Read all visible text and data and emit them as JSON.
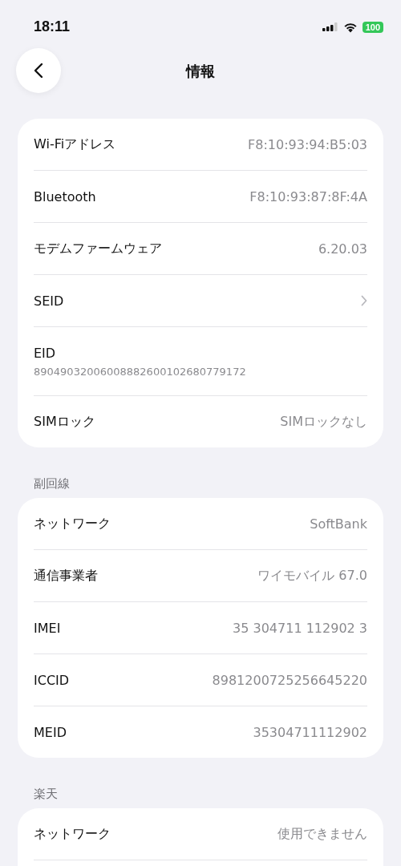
{
  "status_bar": {
    "time": "18:11",
    "battery": "100"
  },
  "header": {
    "title": "情報"
  },
  "sections": [
    {
      "rows": [
        {
          "kind": "value",
          "label": "Wi-Fiアドレス",
          "value": "F8:10:93:94:B5:03"
        },
        {
          "kind": "value",
          "label": "Bluetooth",
          "value": "F8:10:93:87:8F:4A"
        },
        {
          "kind": "value",
          "label": "モデムファームウェア",
          "value": "6.20.03"
        },
        {
          "kind": "link",
          "label": "SEID"
        },
        {
          "kind": "stacked",
          "label": "EID",
          "value": "89049032006008882600102680779172"
        },
        {
          "kind": "value",
          "label": "SIMロック",
          "value": "SIMロックなし"
        }
      ]
    },
    {
      "title": "副回線",
      "rows": [
        {
          "kind": "value",
          "label": "ネットワーク",
          "value": "SoftBank"
        },
        {
          "kind": "value",
          "label": "通信事業者",
          "value": "ワイモバイル 67.0"
        },
        {
          "kind": "value",
          "label": "IMEI",
          "value": "35 304711 112902 3"
        },
        {
          "kind": "value",
          "label": "ICCID",
          "value": "8981200725256645220"
        },
        {
          "kind": "value",
          "label": "MEID",
          "value": "35304711112902"
        }
      ]
    },
    {
      "title": "楽天",
      "rows": [
        {
          "kind": "value",
          "label": "ネットワーク",
          "value": "使用できません"
        },
        {
          "kind": "blank"
        }
      ]
    }
  ]
}
